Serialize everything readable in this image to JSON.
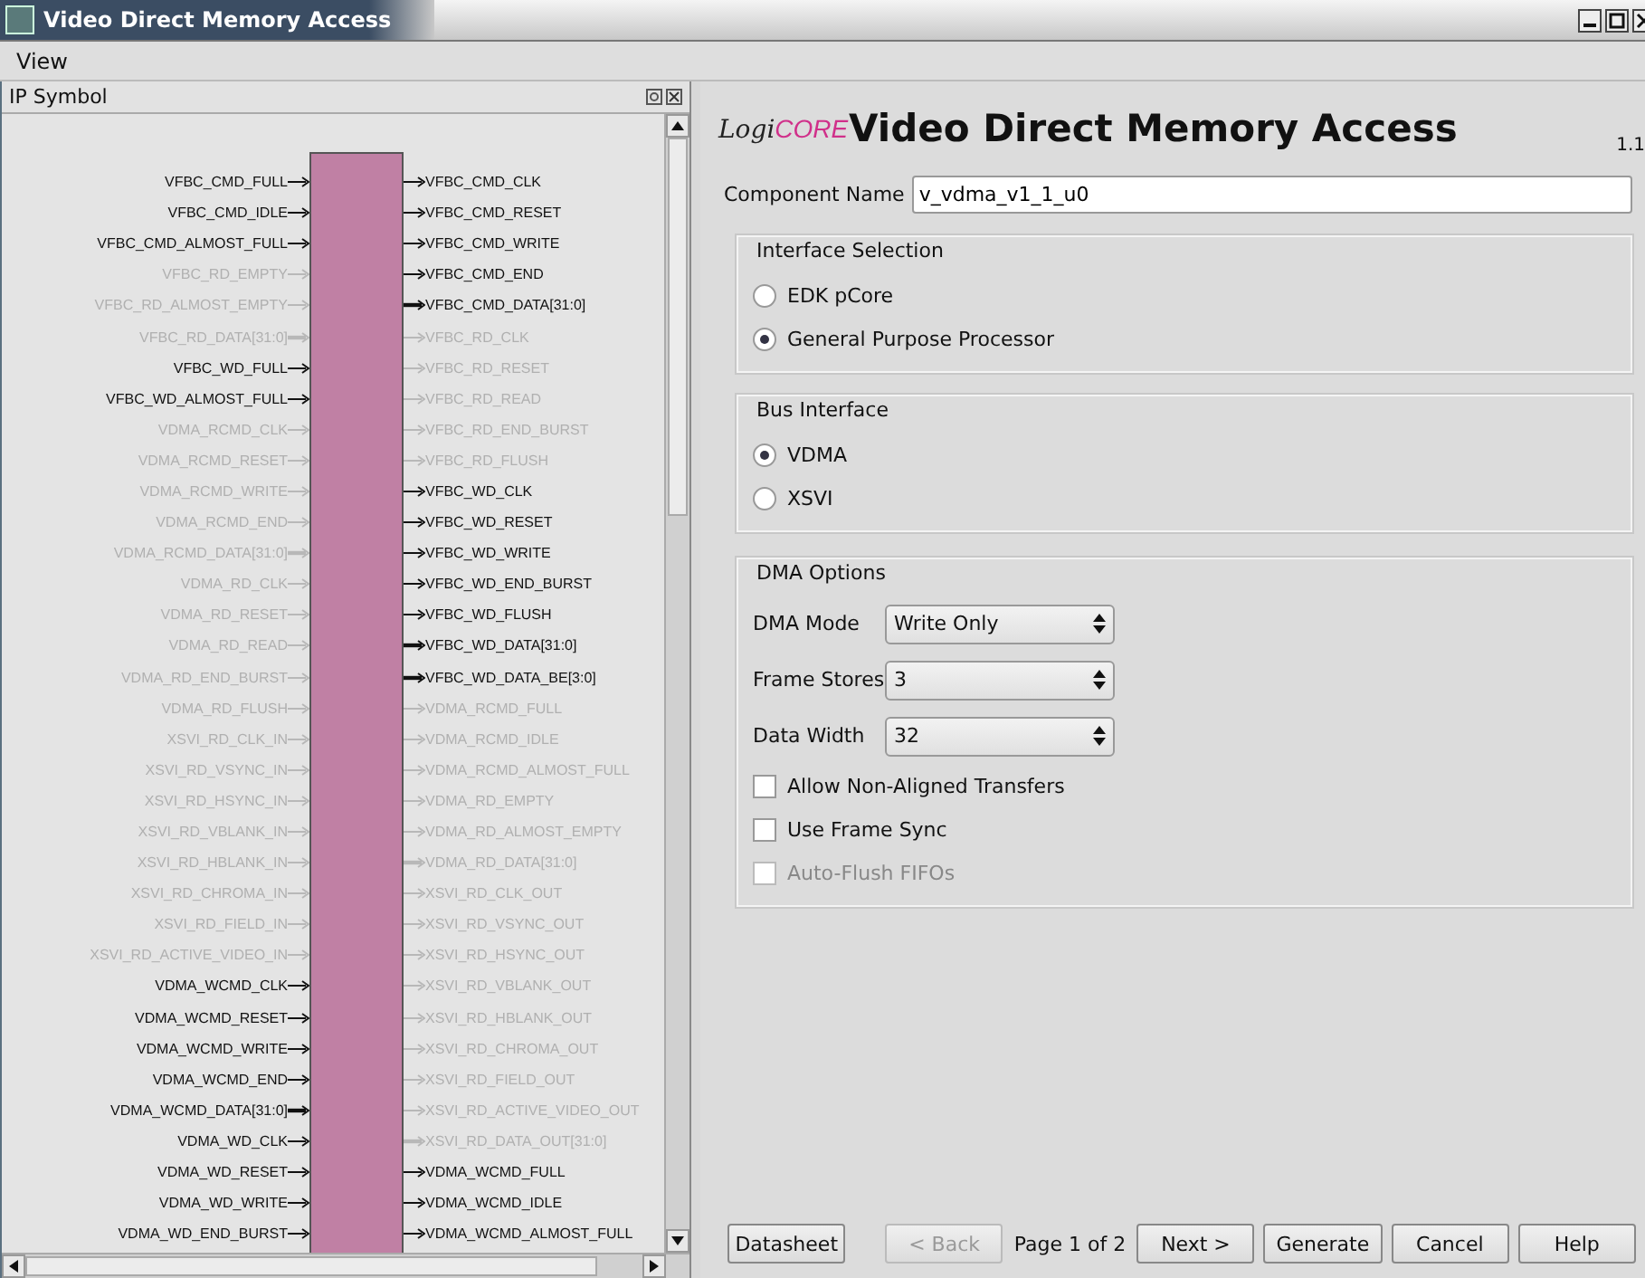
{
  "window": {
    "title": "Video Direct Memory Access"
  },
  "menu": [
    "View"
  ],
  "ip_symbol": {
    "title": "IP Symbol",
    "left_pins": [
      {
        "name": "VFBC_CMD_FULL",
        "enabled": true,
        "bus": false
      },
      {
        "name": "VFBC_CMD_IDLE",
        "enabled": true,
        "bus": false
      },
      {
        "name": "VFBC_CMD_ALMOST_FULL",
        "enabled": true,
        "bus": false
      },
      {
        "name": "VFBC_RD_EMPTY",
        "enabled": false,
        "bus": false
      },
      {
        "name": "VFBC_RD_ALMOST_EMPTY",
        "enabled": false,
        "bus": false
      },
      {
        "name": "VFBC_RD_DATA[31:0]",
        "enabled": false,
        "bus": true
      },
      {
        "name": "VFBC_WD_FULL",
        "enabled": true,
        "bus": false
      },
      {
        "name": "VFBC_WD_ALMOST_FULL",
        "enabled": true,
        "bus": false
      },
      {
        "name": "VDMA_RCMD_CLK",
        "enabled": false,
        "bus": false
      },
      {
        "name": "VDMA_RCMD_RESET",
        "enabled": false,
        "bus": false
      },
      {
        "name": "VDMA_RCMD_WRITE",
        "enabled": false,
        "bus": false
      },
      {
        "name": "VDMA_RCMD_END",
        "enabled": false,
        "bus": false
      },
      {
        "name": "VDMA_RCMD_DATA[31:0]",
        "enabled": false,
        "bus": true
      },
      {
        "name": "VDMA_RD_CLK",
        "enabled": false,
        "bus": false
      },
      {
        "name": "VDMA_RD_RESET",
        "enabled": false,
        "bus": false
      },
      {
        "name": "VDMA_RD_READ",
        "enabled": false,
        "bus": false
      },
      {
        "name": "VDMA_RD_END_BURST",
        "enabled": false,
        "bus": false
      },
      {
        "name": "VDMA_RD_FLUSH",
        "enabled": false,
        "bus": false
      },
      {
        "name": "XSVI_RD_CLK_IN",
        "enabled": false,
        "bus": false
      },
      {
        "name": "XSVI_RD_VSYNC_IN",
        "enabled": false,
        "bus": false
      },
      {
        "name": "XSVI_RD_HSYNC_IN",
        "enabled": false,
        "bus": false
      },
      {
        "name": "XSVI_RD_VBLANK_IN",
        "enabled": false,
        "bus": false
      },
      {
        "name": "XSVI_RD_HBLANK_IN",
        "enabled": false,
        "bus": false
      },
      {
        "name": "XSVI_RD_CHROMA_IN",
        "enabled": false,
        "bus": false
      },
      {
        "name": "XSVI_RD_FIELD_IN",
        "enabled": false,
        "bus": false
      },
      {
        "name": "XSVI_RD_ACTIVE_VIDEO_IN",
        "enabled": false,
        "bus": false
      },
      {
        "name": "VDMA_WCMD_CLK",
        "enabled": true,
        "bus": false
      },
      {
        "name": "VDMA_WCMD_RESET",
        "enabled": true,
        "bus": false
      },
      {
        "name": "VDMA_WCMD_WRITE",
        "enabled": true,
        "bus": false
      },
      {
        "name": "VDMA_WCMD_END",
        "enabled": true,
        "bus": false
      },
      {
        "name": "VDMA_WCMD_DATA[31:0]",
        "enabled": true,
        "bus": true
      },
      {
        "name": "VDMA_WD_CLK",
        "enabled": true,
        "bus": false
      },
      {
        "name": "VDMA_WD_RESET",
        "enabled": true,
        "bus": false
      },
      {
        "name": "VDMA_WD_WRITE",
        "enabled": true,
        "bus": false
      },
      {
        "name": "VDMA_WD_END_BURST",
        "enabled": true,
        "bus": false
      }
    ],
    "right_pins": [
      {
        "name": "VFBC_CMD_CLK",
        "enabled": true,
        "bus": false
      },
      {
        "name": "VFBC_CMD_RESET",
        "enabled": true,
        "bus": false
      },
      {
        "name": "VFBC_CMD_WRITE",
        "enabled": true,
        "bus": false
      },
      {
        "name": "VFBC_CMD_END",
        "enabled": true,
        "bus": false
      },
      {
        "name": "VFBC_CMD_DATA[31:0]",
        "enabled": true,
        "bus": true
      },
      {
        "name": "VFBC_RD_CLK",
        "enabled": false,
        "bus": false
      },
      {
        "name": "VFBC_RD_RESET",
        "enabled": false,
        "bus": false
      },
      {
        "name": "VFBC_RD_READ",
        "enabled": false,
        "bus": false
      },
      {
        "name": "VFBC_RD_END_BURST",
        "enabled": false,
        "bus": false
      },
      {
        "name": "VFBC_RD_FLUSH",
        "enabled": false,
        "bus": false
      },
      {
        "name": "VFBC_WD_CLK",
        "enabled": true,
        "bus": false
      },
      {
        "name": "VFBC_WD_RESET",
        "enabled": true,
        "bus": false
      },
      {
        "name": "VFBC_WD_WRITE",
        "enabled": true,
        "bus": false
      },
      {
        "name": "VFBC_WD_END_BURST",
        "enabled": true,
        "bus": false
      },
      {
        "name": "VFBC_WD_FLUSH",
        "enabled": true,
        "bus": false
      },
      {
        "name": "VFBC_WD_DATA[31:0]",
        "enabled": true,
        "bus": true
      },
      {
        "name": "VFBC_WD_DATA_BE[3:0]",
        "enabled": true,
        "bus": true
      },
      {
        "name": "VDMA_RCMD_FULL",
        "enabled": false,
        "bus": false
      },
      {
        "name": "VDMA_RCMD_IDLE",
        "enabled": false,
        "bus": false
      },
      {
        "name": "VDMA_RCMD_ALMOST_FULL",
        "enabled": false,
        "bus": false
      },
      {
        "name": "VDMA_RD_EMPTY",
        "enabled": false,
        "bus": false
      },
      {
        "name": "VDMA_RD_ALMOST_EMPTY",
        "enabled": false,
        "bus": false
      },
      {
        "name": "VDMA_RD_DATA[31:0]",
        "enabled": false,
        "bus": true
      },
      {
        "name": "XSVI_RD_CLK_OUT",
        "enabled": false,
        "bus": false
      },
      {
        "name": "XSVI_RD_VSYNC_OUT",
        "enabled": false,
        "bus": false
      },
      {
        "name": "XSVI_RD_HSYNC_OUT",
        "enabled": false,
        "bus": false
      },
      {
        "name": "XSVI_RD_VBLANK_OUT",
        "enabled": false,
        "bus": false
      },
      {
        "name": "XSVI_RD_HBLANK_OUT",
        "enabled": false,
        "bus": false
      },
      {
        "name": "XSVI_RD_CHROMA_OUT",
        "enabled": false,
        "bus": false
      },
      {
        "name": "XSVI_RD_FIELD_OUT",
        "enabled": false,
        "bus": false
      },
      {
        "name": "XSVI_RD_ACTIVE_VIDEO_OUT",
        "enabled": false,
        "bus": false
      },
      {
        "name": "XSVI_RD_DATA_OUT[31:0]",
        "enabled": false,
        "bus": true
      },
      {
        "name": "VDMA_WCMD_FULL",
        "enabled": true,
        "bus": false
      },
      {
        "name": "VDMA_WCMD_IDLE",
        "enabled": true,
        "bus": false
      },
      {
        "name": "VDMA_WCMD_ALMOST_FULL",
        "enabled": true,
        "bus": false
      }
    ]
  },
  "header": {
    "logo_prefix": "Logi",
    "logo_suffix": "CORE",
    "title": "Video Direct Memory Access",
    "version": "1.1"
  },
  "component_name": {
    "label": "Component Name",
    "value": "v_vdma_v1_1_u0"
  },
  "interface_selection": {
    "title": "Interface Selection",
    "options": [
      {
        "label": "EDK pCore",
        "selected": false
      },
      {
        "label": "General Purpose Processor",
        "selected": true
      }
    ]
  },
  "bus_interface": {
    "title": "Bus Interface",
    "options": [
      {
        "label": "VDMA",
        "selected": true
      },
      {
        "label": "XSVI",
        "selected": false
      }
    ]
  },
  "dma_options": {
    "title": "DMA Options",
    "selects": [
      {
        "label": "DMA Mode",
        "value": "Write Only"
      },
      {
        "label": "Frame Stores",
        "value": "3"
      },
      {
        "label": "Data Width",
        "value": "32"
      }
    ],
    "checkboxes": [
      {
        "label": "Allow Non-Aligned Transfers",
        "checked": false,
        "disabled": false
      },
      {
        "label": "Use Frame Sync",
        "checked": false,
        "disabled": false
      },
      {
        "label": "Auto-Flush FIFOs",
        "checked": false,
        "disabled": true
      }
    ]
  },
  "footer": {
    "datasheet": "Datasheet",
    "back": {
      "label": "< Back",
      "disabled": true
    },
    "page": "Page 1 of 2",
    "buttons": [
      "Next >",
      "Generate",
      "Cancel",
      "Help"
    ]
  }
}
